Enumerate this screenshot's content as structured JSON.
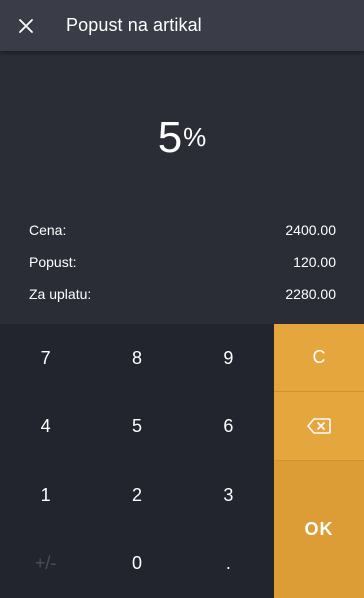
{
  "header": {
    "title": "Popust na artikal",
    "close_icon": "close-icon"
  },
  "display": {
    "value": "5",
    "unit": "%"
  },
  "summary": [
    {
      "label": "Cena:",
      "value": "2400.00"
    },
    {
      "label": "Popust:",
      "value": "120.00"
    },
    {
      "label": "Za uplatu:",
      "value": "2280.00"
    }
  ],
  "keypad": {
    "keys": [
      "7",
      "8",
      "9",
      "4",
      "5",
      "6",
      "1",
      "2",
      "3",
      "+/-",
      "0",
      "."
    ]
  },
  "actions": {
    "clear_label": "C",
    "backspace_icon": "backspace-icon",
    "ok_label": "OK"
  },
  "colors": {
    "background": "#2a2d36",
    "header": "#3a3d47",
    "keypad": "#22252d",
    "accent": "#e5a63d",
    "disabled_key": "#4a4d57"
  }
}
